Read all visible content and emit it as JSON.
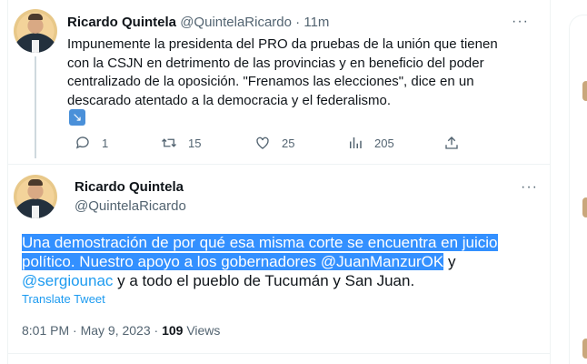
{
  "tweet1": {
    "author_name": "Ricardo Quintela",
    "author_handle": "@QuintelaRicardo",
    "separator": "·",
    "time": "11m",
    "text": "Impunemente la presidenta del PRO da pruebas de la unión que tienen con la CSJN en detrimento de las provincias y en beneficio del poder centralizado de la oposición. \"Frenamos las elecciones\", dice en un descarado atentado a la democracia y el federalismo.",
    "emoji": "↘",
    "replies": "1",
    "retweets": "15",
    "likes": "25",
    "views": "205"
  },
  "tweet2": {
    "author_name": "Ricardo Quintela",
    "author_handle": "@QuintelaRicardo",
    "text_highlighted": "Una demostración de por qué esa misma corte se encuentra en juicio político. Nuestro apoyo a los gobernadores ",
    "mention1": "@JuanManzurOK",
    "text_mid": " y",
    "mention2": "@sergiounac",
    "text_end": " y a todo el pueblo de Tucumán y San Juan.",
    "translate_label": "Translate Tweet",
    "time": "8:01 PM · May 9, 2023 ·",
    "views_count": "109",
    "views_label": "Views"
  },
  "more_label": "···",
  "accent_color": "#1d9bf0",
  "selection_color": "#3390ff"
}
